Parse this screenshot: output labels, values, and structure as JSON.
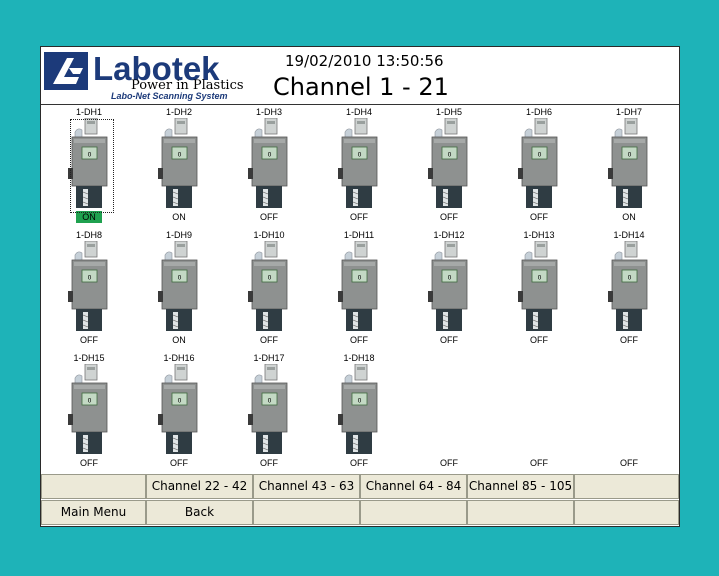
{
  "header": {
    "logo_text": "Labotek",
    "tagline": "Power in Plastics",
    "subtagline": "Labo-Net Scanning System",
    "datetime": "19/02/2010 13:50:56",
    "title": "Channel 1 - 21"
  },
  "units": [
    {
      "name": "1-DH1",
      "status": "ON",
      "highlight": true
    },
    {
      "name": "1-DH2",
      "status": "ON"
    },
    {
      "name": "1-DH3",
      "status": "OFF"
    },
    {
      "name": "1-DH4",
      "status": "OFF"
    },
    {
      "name": "1-DH5",
      "status": "OFF"
    },
    {
      "name": "1-DH6",
      "status": "OFF"
    },
    {
      "name": "1-DH7",
      "status": "ON"
    },
    {
      "name": "1-DH8",
      "status": "OFF"
    },
    {
      "name": "1-DH9",
      "status": "ON"
    },
    {
      "name": "1-DH10",
      "status": "OFF"
    },
    {
      "name": "1-DH11",
      "status": "OFF"
    },
    {
      "name": "1-DH12",
      "status": "OFF"
    },
    {
      "name": "1-DH13",
      "status": "OFF"
    },
    {
      "name": "1-DH14",
      "status": "OFF"
    },
    {
      "name": "1-DH15",
      "status": "OFF"
    },
    {
      "name": "1-DH16",
      "status": "OFF"
    },
    {
      "name": "1-DH17",
      "status": "OFF"
    },
    {
      "name": "1-DH18",
      "status": "OFF"
    },
    {
      "name": "",
      "status": "OFF"
    },
    {
      "name": "",
      "status": "OFF"
    },
    {
      "name": "",
      "status": "OFF"
    }
  ],
  "display_value": "0",
  "buttons": {
    "row1": [
      "",
      "Channel 22 - 42",
      "Channel 43 - 63",
      "Channel 64 - 84",
      "Channel 85 - 105",
      ""
    ],
    "row2": [
      "Main Menu",
      "Back",
      "",
      "",
      "",
      ""
    ]
  },
  "colors": {
    "background": "#1eb3b8",
    "on_highlight": "#1fa14f",
    "logo_blue": "#1c3a7a",
    "button_face": "#ece9d8"
  }
}
